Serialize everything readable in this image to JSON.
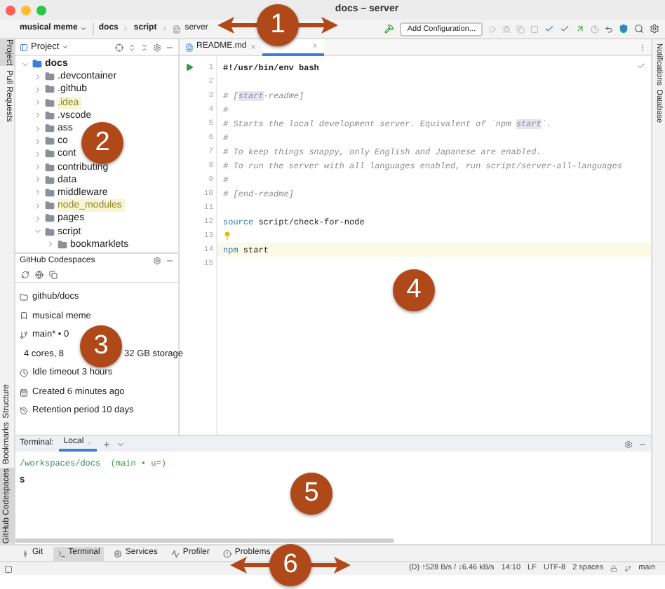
{
  "window": {
    "title": "docs – server"
  },
  "toolbar": {
    "project": "musical meme",
    "breadcrumb": [
      "docs",
      "script",
      "server"
    ],
    "run_config": "Add Configuration..."
  },
  "left_strip": [
    {
      "label": "Project",
      "selected": true
    },
    {
      "label": "Pull Requests",
      "selected": false
    }
  ],
  "left_strip_bottom": [
    {
      "label": "Structure",
      "selected": false
    },
    {
      "label": "Bookmarks",
      "selected": false
    },
    {
      "label": "GitHub Codespaces",
      "selected": true
    }
  ],
  "right_strip": [
    {
      "label": "Notifications"
    },
    {
      "label": "Database"
    }
  ],
  "project_panel": {
    "title": "Project",
    "tree": [
      {
        "name": "docs",
        "expanded": true,
        "excluded": false,
        "children": [
          {
            "name": ".devcontainer",
            "expanded": false,
            "excluded": false
          },
          {
            "name": ".github",
            "expanded": false,
            "excluded": false
          },
          {
            "name": ".idea",
            "expanded": false,
            "excluded": true
          },
          {
            "name": ".vscode",
            "expanded": false,
            "excluded": false
          },
          {
            "name": "ass",
            "expanded": false,
            "excluded": false
          },
          {
            "name": "co",
            "expanded": false,
            "excluded": false
          },
          {
            "name": "cont",
            "expanded": false,
            "excluded": false
          },
          {
            "name": "contributing",
            "expanded": false,
            "excluded": false
          },
          {
            "name": "data",
            "expanded": false,
            "excluded": false
          },
          {
            "name": "middleware",
            "expanded": false,
            "excluded": false
          },
          {
            "name": "node_modules",
            "expanded": false,
            "excluded": true
          },
          {
            "name": "pages",
            "expanded": false,
            "excluded": false
          },
          {
            "name": "script",
            "expanded": true,
            "excluded": false,
            "children": [
              {
                "name": "bookmarklets",
                "expanded": false,
                "excluded": false
              }
            ]
          }
        ]
      }
    ]
  },
  "codespaces": {
    "title": "GitHub Codespaces",
    "details": [
      {
        "kind": "repo",
        "text": "github/docs"
      },
      {
        "kind": "name",
        "text": "musical meme"
      },
      {
        "kind": "branch",
        "text": "main* • 0"
      },
      {
        "kind": "machine",
        "text": "4 cores, 8",
        "text_2": "32 GB storage"
      },
      {
        "kind": "timeout",
        "text": "Idle timeout 3 hours"
      },
      {
        "kind": "created",
        "text": "Created 6 minutes ago"
      },
      {
        "kind": "retention",
        "text": "Retention period 10 days"
      }
    ]
  },
  "editor": {
    "tabs": [
      {
        "label": "README.md",
        "selected": false
      },
      {
        "selected": true
      }
    ],
    "lines": [
      {
        "number": "1",
        "runnable": true,
        "hint": false,
        "current": false,
        "tokens": [
          {
            "kind": "shebang",
            "text": "#!/usr/bin/env bash"
          }
        ]
      },
      {
        "number": "2",
        "runnable": false,
        "hint": false,
        "current": false
      },
      {
        "number": "3",
        "runnable": false,
        "hint": false,
        "current": false,
        "tokens": [
          {
            "kind": "comment",
            "text": "# ["
          },
          {
            "kind": "occurrence",
            "text": "start"
          },
          {
            "kind": "comment",
            "text": "-readme]"
          }
        ]
      },
      {
        "number": "4",
        "runnable": false,
        "hint": false,
        "current": false,
        "tokens": [
          {
            "kind": "comment",
            "text": "#"
          }
        ]
      },
      {
        "number": "5",
        "runnable": false,
        "hint": false,
        "current": false,
        "tokens": [
          {
            "kind": "comment",
            "text": "# Starts the local development server. Equivalent of `npm "
          },
          {
            "kind": "occurrence",
            "text": "start"
          },
          {
            "kind": "comment",
            "text": "`."
          }
        ]
      },
      {
        "number": "6",
        "runnable": false,
        "hint": false,
        "current": false,
        "tokens": [
          {
            "kind": "comment",
            "text": "#"
          }
        ]
      },
      {
        "number": "7",
        "runnable": false,
        "hint": false,
        "current": false,
        "tokens": [
          {
            "kind": "comment",
            "text": "# To keep things snappy, only English and Japanese are enabled."
          }
        ]
      },
      {
        "number": "8",
        "runnable": false,
        "hint": false,
        "current": false,
        "tokens": [
          {
            "kind": "comment",
            "text": "# To run the server with all languages enabled, run script/server-all-languages"
          }
        ]
      },
      {
        "number": "9",
        "runnable": false,
        "hint": false,
        "current": false,
        "tokens": [
          {
            "kind": "comment",
            "text": "#"
          }
        ]
      },
      {
        "number": "10",
        "runnable": false,
        "hint": false,
        "current": false,
        "tokens": [
          {
            "kind": "comment",
            "text": "# [end-readme]"
          }
        ]
      },
      {
        "number": "11",
        "runnable": false,
        "hint": false,
        "current": false
      },
      {
        "number": "12",
        "runnable": false,
        "hint": false,
        "current": false,
        "tokens": [
          {
            "kind": "keyword",
            "text": "source"
          },
          {
            "kind": "plain",
            "text": " script/check-for-node"
          }
        ]
      },
      {
        "number": "13",
        "runnable": false,
        "hint": true,
        "current": false
      },
      {
        "number": "14",
        "runnable": false,
        "hint": false,
        "current": true,
        "tokens": [
          {
            "kind": "keyword",
            "text": "npm"
          },
          {
            "kind": "plain",
            "text": " start"
          }
        ]
      },
      {
        "number": "15",
        "runnable": false,
        "hint": false,
        "current": false
      }
    ]
  },
  "terminal": {
    "label": "Terminal:",
    "tabs": [
      {
        "label": "Local",
        "selected": true
      }
    ],
    "path": "/workspaces/docs",
    "branch": "(main • u=)",
    "prompt": "$"
  },
  "tool_tabs": [
    {
      "label": "Git",
      "kind": "git",
      "selected": false
    },
    {
      "label": "Terminal",
      "kind": "terminal",
      "selected": true
    },
    {
      "label": "Services",
      "kind": "services",
      "selected": false
    },
    {
      "label": "Profiler",
      "kind": "profiler",
      "selected": false
    },
    {
      "label": "Problems",
      "kind": "problems",
      "selected": false
    }
  ],
  "status_bar": {
    "network": "(D) ↑528 B/s / ↓6.46 kB/s",
    "position": "14:10",
    "line_ending": "LF",
    "encoding": "UTF-8",
    "indent": "2 spaces",
    "branch": "main"
  },
  "annotations": [
    {
      "number": "1",
      "kind": "double_arrow"
    },
    {
      "number": "2",
      "kind": "circle"
    },
    {
      "number": "3",
      "kind": "circle"
    },
    {
      "number": "4",
      "kind": "circle"
    },
    {
      "number": "5",
      "kind": "circle"
    },
    {
      "number": "6",
      "kind": "double_arrow"
    }
  ]
}
